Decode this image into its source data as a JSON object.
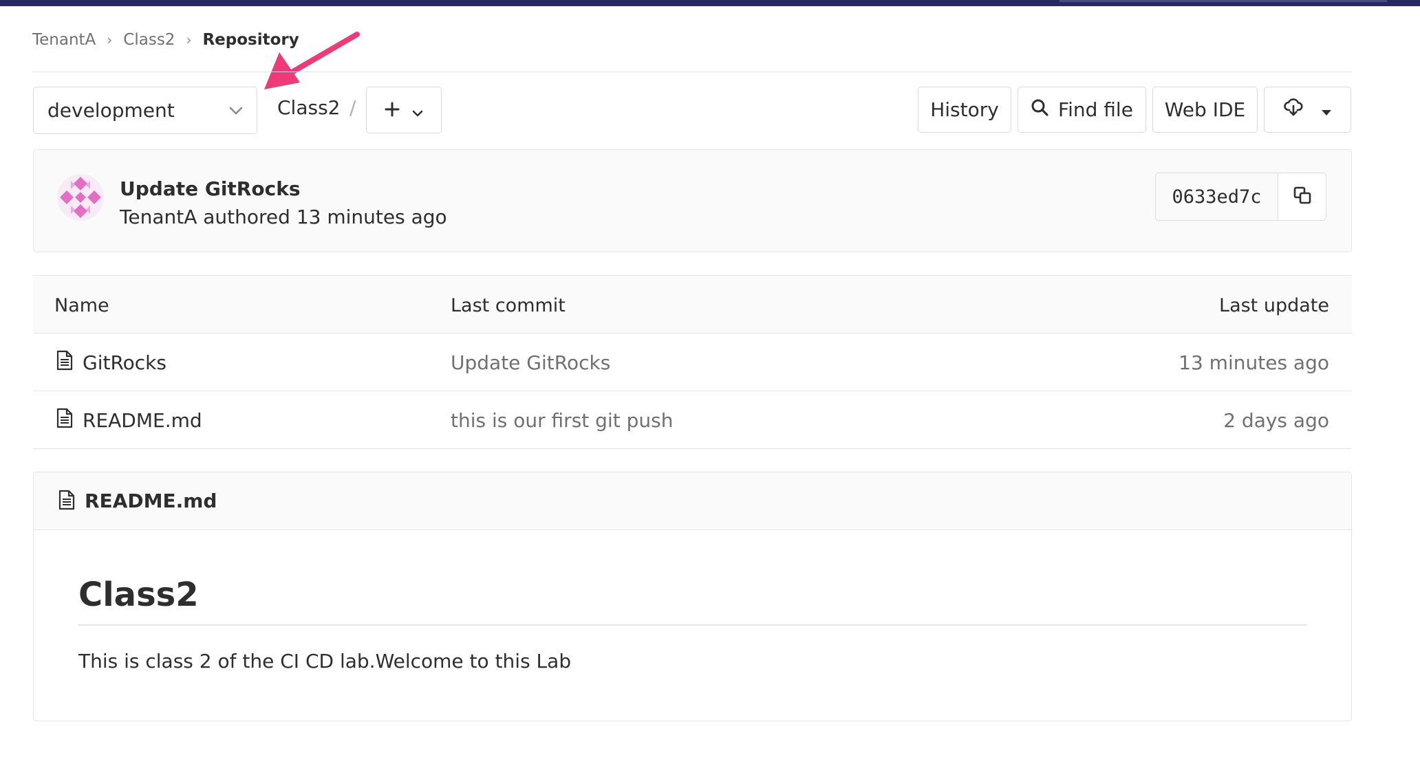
{
  "breadcrumb": {
    "items": [
      "TenantA",
      "Class2"
    ],
    "current": "Repository"
  },
  "toolbar": {
    "branch": "development",
    "path": "Class2",
    "path_separator": "/",
    "history_label": "History",
    "find_file_label": "Find file",
    "web_ide_label": "Web IDE"
  },
  "last_commit": {
    "title": "Update GitRocks",
    "meta": "TenantA authored 13 minutes ago",
    "sha": "0633ed7c"
  },
  "file_table": {
    "headers": {
      "name": "Name",
      "last_commit": "Last commit",
      "last_update": "Last update"
    },
    "rows": [
      {
        "name": "GitRocks",
        "last_commit": "Update GitRocks",
        "last_update": "13 minutes ago"
      },
      {
        "name": "README.md",
        "last_commit": "this is our first git push",
        "last_update": "2 days ago"
      }
    ]
  },
  "readme": {
    "filename": "README.md",
    "heading": "Class2",
    "paragraph": "This is class 2 of the CI CD lab.Welcome to this Lab"
  },
  "icons": {
    "branch_dropdown": "chevron-down-icon",
    "add": "plus-icon",
    "search": "search-icon",
    "download": "cloud-download-icon",
    "copy": "copy-icon",
    "file": "file-icon",
    "annotation": "arrow-icon"
  },
  "colors": {
    "topbar": "#292961",
    "annotation_arrow": "#ee3a78",
    "avatar": "#e36fc2",
    "muted_text": "#707070",
    "border": "#e5e5e5"
  }
}
